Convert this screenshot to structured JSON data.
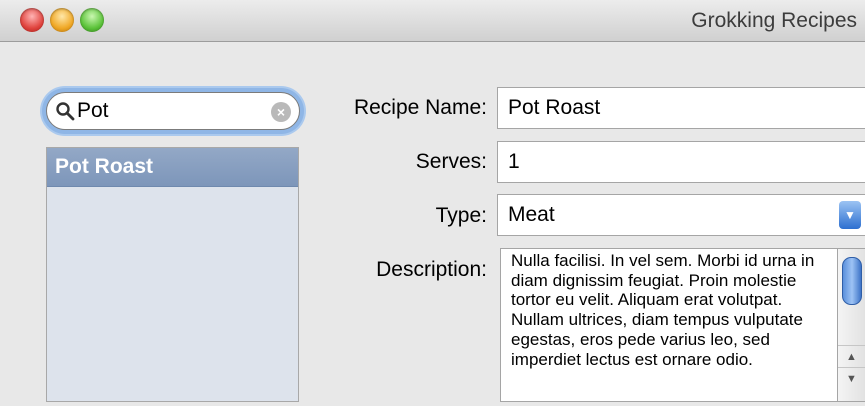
{
  "window": {
    "title": "Grokking Recipes"
  },
  "search": {
    "value": "Pot",
    "clear_symbol": "×"
  },
  "recipe_list": {
    "items": [
      {
        "label": "Pot Roast",
        "selected": true
      }
    ]
  },
  "form": {
    "name_label": "Recipe Name:",
    "name_value": "Pot Roast",
    "serves_label": "Serves:",
    "serves_value": "1",
    "type_label": "Type:",
    "type_value": "Meat",
    "description_label": "Description:",
    "description_text": "Nulla facilisi. In vel sem. Morbi id urna in diam dignissim feugiat. Proin molestie tortor eu velit. Aliquam erat volutpat. Nullam ultrices, diam tempus vulputate egestas, eros pede varius leo, sed imperdiet lectus est ornare odio."
  },
  "icons": {
    "search": "magnifier-icon",
    "clear": "clear-search-icon",
    "dropdown": "chevron-down-icon",
    "scroll_up": "arrow-up-icon",
    "scroll_down": "arrow-down-icon"
  },
  "colors": {
    "selection": "#7d96ba",
    "focus_ring": "#8fb6e6",
    "list_background": "#dde3ec"
  }
}
